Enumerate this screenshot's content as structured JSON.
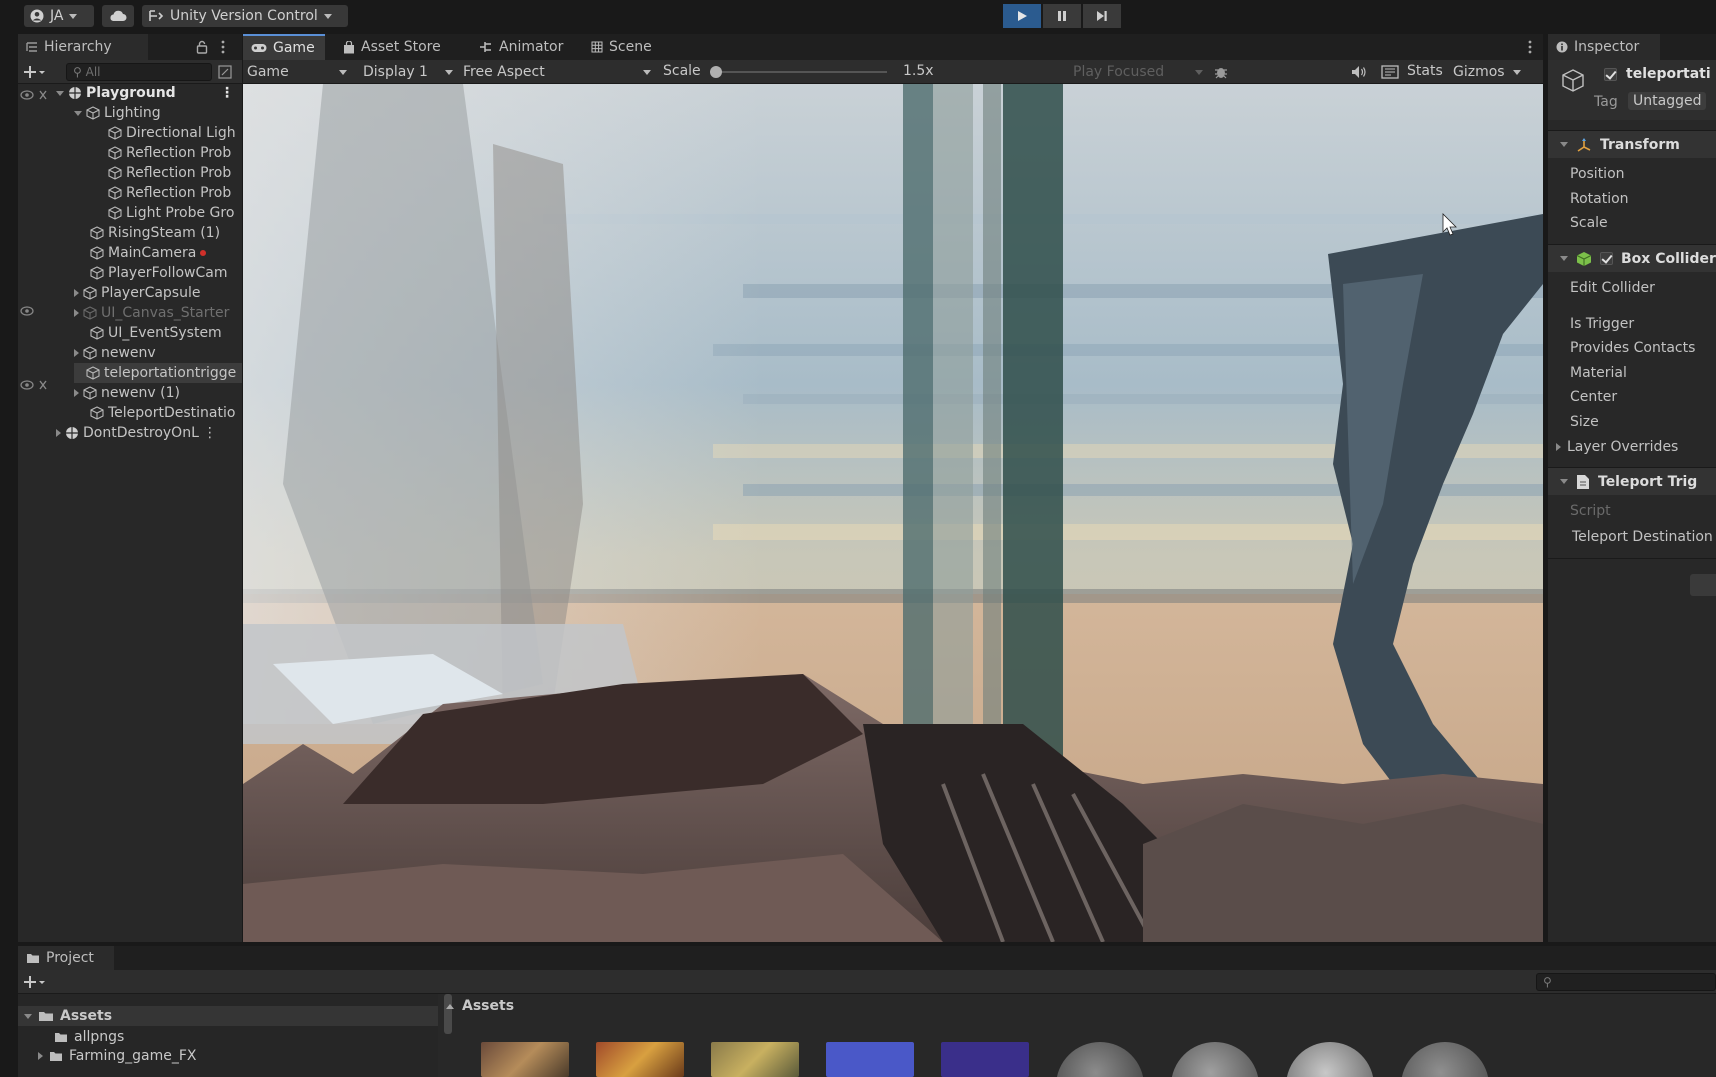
{
  "toolbar": {
    "account_label": "JA",
    "version_control_label": "Unity Version Control"
  },
  "hierarchy": {
    "tab_label": "Hierarchy",
    "search_placeholder": "All",
    "items": [
      {
        "label": "Playground"
      },
      {
        "label": "Lighting"
      },
      {
        "label": "Directional Ligh"
      },
      {
        "label": "Reflection Prob"
      },
      {
        "label": "Reflection Prob"
      },
      {
        "label": "Reflection Prob"
      },
      {
        "label": "Light Probe Gro"
      },
      {
        "label": "RisingSteam (1)"
      },
      {
        "label": "MainCamera"
      },
      {
        "label": "PlayerFollowCam"
      },
      {
        "label": "PlayerCapsule"
      },
      {
        "label": "UI_Canvas_Starter"
      },
      {
        "label": "UI_EventSystem"
      },
      {
        "label": "newenv"
      },
      {
        "label": "teleportationtrigge"
      },
      {
        "label": "newenv (1)"
      },
      {
        "label": "TeleportDestinatio"
      },
      {
        "label": "DontDestroyOnL"
      }
    ]
  },
  "tabs": {
    "game": "Game",
    "asset_store": "Asset Store",
    "animator": "Animator",
    "scene": "Scene"
  },
  "game_toolbar": {
    "mode": "Game",
    "display": "Display 1",
    "aspect": "Free Aspect",
    "scale_label": "Scale",
    "scale_value": "1.5x",
    "scale_fraction": 0.0,
    "play_focused": "Play Focused",
    "stats": "Stats",
    "gizmos": "Gizmos"
  },
  "inspector": {
    "tab_label": "Inspector",
    "object_name": "teleportati",
    "tag_label": "Tag",
    "tag_value": "Untagged",
    "transform": {
      "title": "Transform",
      "position": "Position",
      "rotation": "Rotation",
      "scale": "Scale"
    },
    "box_collider": {
      "title": "Box Collider",
      "edit_collider": "Edit Collider",
      "is_trigger": "Is Trigger",
      "provides_contacts": "Provides Contacts",
      "material": "Material",
      "center": "Center",
      "size": "Size",
      "layer_overrides": "Layer Overrides"
    },
    "teleport_trigger": {
      "title": "Teleport Trig",
      "script": "Script",
      "teleport_destination": "Teleport Destination"
    }
  },
  "project": {
    "tab_label": "Project",
    "breadcrumb": "Assets",
    "tree": [
      {
        "label": "Assets"
      },
      {
        "label": "allpngs"
      },
      {
        "label": "Farming_game_FX"
      }
    ]
  },
  "colors": {
    "accent": "#2b5b8f",
    "panel": "#282828",
    "background": "#191919"
  }
}
